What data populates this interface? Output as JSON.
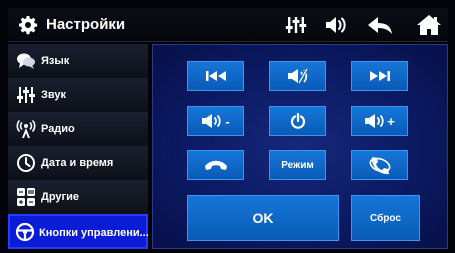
{
  "header": {
    "title": "Настройки",
    "icons": [
      "gear-icon",
      "equalizer-icon",
      "volume-icon",
      "back-icon",
      "home-icon"
    ]
  },
  "sidebar": {
    "items": [
      {
        "label": "Язык",
        "icon": "language-icon",
        "active": false
      },
      {
        "label": "Звук",
        "icon": "sliders-icon",
        "active": false
      },
      {
        "label": "Радио",
        "icon": "radio-icon",
        "active": false
      },
      {
        "label": "Дата и время",
        "icon": "clock-icon",
        "active": false
      },
      {
        "label": "Другие",
        "icon": "other-icon",
        "active": false
      },
      {
        "label": "Кнопки управлени...",
        "icon": "steering-wheel-icon",
        "active": true
      }
    ]
  },
  "controls": {
    "buttons": [
      {
        "id": "prev",
        "icon": "previous-track-icon"
      },
      {
        "id": "mute",
        "icon": "mute-icon"
      },
      {
        "id": "next",
        "icon": "next-track-icon"
      },
      {
        "id": "vol-down",
        "icon": "volume-down-icon",
        "suffix": "-"
      },
      {
        "id": "power",
        "icon": "power-icon"
      },
      {
        "id": "vol-up",
        "icon": "volume-up-icon",
        "suffix": "+"
      },
      {
        "id": "call-end",
        "icon": "hang-up-icon"
      },
      {
        "id": "mode",
        "label": "Режим"
      },
      {
        "id": "call-answer",
        "icon": "answer-call-icon"
      }
    ],
    "ok_label": "OK",
    "reset_label": "Сброс"
  },
  "colors": {
    "accent": "#0a1cd6",
    "button": "#1576d8",
    "panel": "#0b1a63"
  }
}
